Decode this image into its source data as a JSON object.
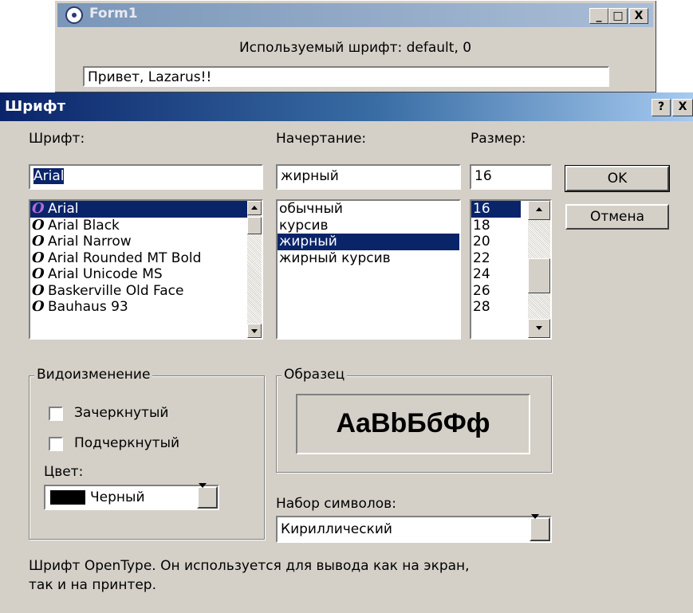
{
  "form1": {
    "title": "Form1",
    "used_font_text": "Используемый шрифт:  default, 0",
    "edit_value": "Привет, Lazarus!!",
    "minimize": "_",
    "maximize": "□",
    "close": "X"
  },
  "dialog": {
    "title": "Шрифт",
    "help_button": "?",
    "close_button": "X",
    "font": {
      "label": "Шрифт:",
      "value": "Arial",
      "items": [
        "Arial",
        "Arial Black",
        "Arial Narrow",
        "Arial Rounded MT Bold",
        "Arial Unicode MS",
        "Baskerville Old Face",
        "Bauhaus 93"
      ],
      "selected_index": 0
    },
    "style": {
      "label": "Начертание:",
      "value": "жирный",
      "items": [
        "обычный",
        "курсив",
        "жирный",
        "жирный курсив"
      ],
      "selected_index": 2
    },
    "size": {
      "label": "Размер:",
      "value": "16",
      "items": [
        "16",
        "18",
        "20",
        "22",
        "24",
        "26",
        "28"
      ],
      "selected_index": 0
    },
    "ok_label": "OK",
    "cancel_label": "Отмена",
    "effects": {
      "legend": "Видоизменение",
      "strikeout": "Зачеркнутый",
      "underline": "Подчеркнутый",
      "color_label": "Цвет:",
      "color_value": "Черный",
      "color_swatch": "#000000"
    },
    "sample": {
      "legend": "Образец",
      "text": "AaBbБбФф"
    },
    "charset": {
      "label": "Набор символов:",
      "value": "Кириллический"
    },
    "description_line1": "Шрифт OpenType. Он используется для вывода как на экран,",
    "description_line2": "так и на принтер."
  },
  "colors": {
    "title_active": "#0a246a",
    "selection": "#0a246a",
    "face": "#d4d0c8"
  }
}
